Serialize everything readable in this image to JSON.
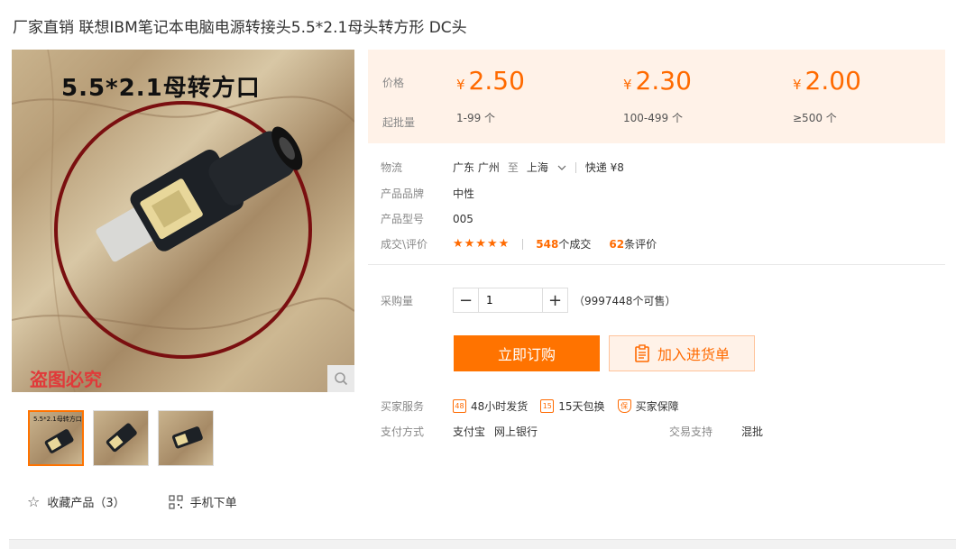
{
  "title": "厂家直销 联想IBM笔记本电脑电源转接头5.5*2.1母头转方形 DC头",
  "main_image": {
    "overlay_text": "5.5*2.1母转方口",
    "watermark": "盗图必究"
  },
  "thumbnails": [
    {
      "label": "5.5*2.1母转方口"
    },
    {
      "label": ""
    },
    {
      "label": ""
    }
  ],
  "bottom_links": {
    "favorite": "收藏产品（3）",
    "mobile": "手机下单"
  },
  "price_panel": {
    "price_label": "价格",
    "moq_label": "起批量",
    "tiers": [
      {
        "currency": "¥",
        "price": "2.50",
        "range": "1-99 个"
      },
      {
        "currency": "¥",
        "price": "2.30",
        "range": "100-499 个"
      },
      {
        "currency": "¥",
        "price": "2.00",
        "range": "≥500 个"
      }
    ]
  },
  "logistics": {
    "label": "物流",
    "from": "广东 广州",
    "to_word": "至",
    "to": "上海",
    "method": "快递 ¥8"
  },
  "brand": {
    "label": "产品品牌",
    "value": "中性"
  },
  "model": {
    "label": "产品型号",
    "value": "005"
  },
  "deals": {
    "label": "成交\\评价",
    "stars": "★★★★★",
    "deals_count": "548",
    "deals_suffix": "个成交",
    "reviews_count": "62",
    "reviews_suffix": "条评价"
  },
  "quantity": {
    "label": "采购量",
    "minus": "−",
    "value": "1",
    "plus": "+",
    "stock": "（9997448个可售）"
  },
  "buttons": {
    "buy_now": "立即订购",
    "add_to_cart": "加入进货单"
  },
  "services": {
    "label": "买家服务",
    "items": [
      {
        "icon": "48",
        "text": "48小时发货"
      },
      {
        "icon": "15",
        "text": "15天包换"
      },
      {
        "icon": "保",
        "text": "买家保障"
      }
    ]
  },
  "payment": {
    "label": "支付方式",
    "methods": [
      "支付宝",
      "网上银行"
    ],
    "trade_label": "交易支持",
    "trade_value": "混批"
  },
  "colors": {
    "accent": "#ff6a00",
    "panel": "#fff2e8"
  }
}
